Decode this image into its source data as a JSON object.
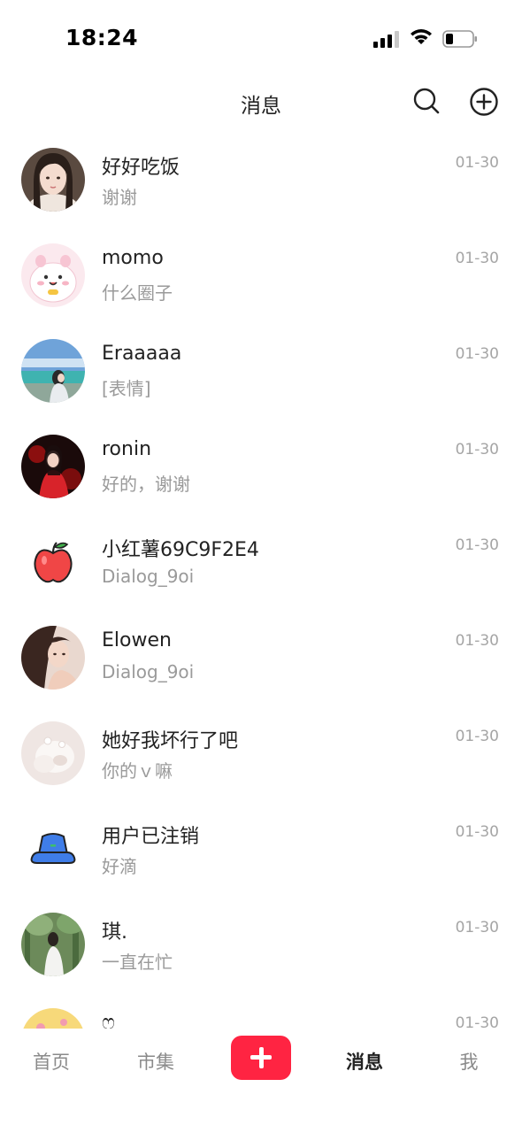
{
  "status_bar": {
    "time": "18:24"
  },
  "header": {
    "title": "消息",
    "search_icon": "search-icon",
    "add_icon": "plus-circle-icon"
  },
  "messages": [
    {
      "name": "好好吃饭",
      "preview": "谢谢",
      "time": "01-30",
      "avatar": "photo-girl"
    },
    {
      "name": "momo",
      "preview": "什么圈子",
      "time": "01-30",
      "avatar": "cartoon-pink"
    },
    {
      "name": "Eraaaaa",
      "preview": "[表情]",
      "time": "01-30",
      "avatar": "photo-beach"
    },
    {
      "name": "ronin",
      "preview": "好的，谢谢",
      "time": "01-30",
      "avatar": "photo-red-dress"
    },
    {
      "name": "小红薯69C9F2E4",
      "preview": "Dialog_9oi",
      "time": "01-30",
      "avatar": "apple-icon"
    },
    {
      "name": "Elowen",
      "preview": "Dialog_9oi",
      "time": "01-30",
      "avatar": "photo-girl-2"
    },
    {
      "name": "她好我坏行了吧",
      "preview": "你的ｖ嘛",
      "time": "01-30",
      "avatar": "photo-white-blob"
    },
    {
      "name": "用户已注销",
      "preview": "好滴",
      "time": "01-30",
      "avatar": "bucket-hat-icon"
    },
    {
      "name": "琪.",
      "preview": "一直在忙",
      "time": "01-30",
      "avatar": "photo-forest"
    },
    {
      "name": "ෆ",
      "preview": "",
      "time": "01-30",
      "avatar": "photo-yellow"
    }
  ],
  "tab_bar": {
    "home": "首页",
    "market": "市集",
    "publish_icon": "plus-icon",
    "messages": "消息",
    "me": "我"
  },
  "colors": {
    "accent": "#ff2442",
    "text": "#222222",
    "secondary": "#9a9a9a"
  }
}
